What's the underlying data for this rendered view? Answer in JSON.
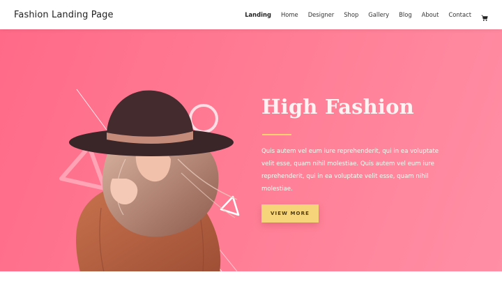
{
  "site": {
    "logo_text": "Fashion Landing Page"
  },
  "nav": {
    "items": [
      {
        "label": "Landing",
        "active": true
      },
      {
        "label": "Home",
        "active": false
      },
      {
        "label": "Designer",
        "active": false
      },
      {
        "label": "Shop",
        "active": false
      },
      {
        "label": "Gallery",
        "active": false
      },
      {
        "label": "Blog",
        "active": false
      },
      {
        "label": "About",
        "active": false
      },
      {
        "label": "Contact",
        "active": false
      }
    ],
    "cart_icon": "shopping-cart-icon"
  },
  "hero": {
    "title": "High Fashion",
    "body": "Quis autem vel eum iure reprehenderit, qui in ea voluptate velit esse, quam nihil molestiae. Quis autem vel eum iure reprehenderit, qui in ea voluptate velit esse, quam nihil molestiae.",
    "cta_label": "VIEW MORE"
  },
  "colors": {
    "hero_gradient_start": "#ff6a88",
    "hero_gradient_end": "#ff8fa5",
    "accent_gold": "#f6d47a",
    "title_color": "#fff3f4"
  }
}
